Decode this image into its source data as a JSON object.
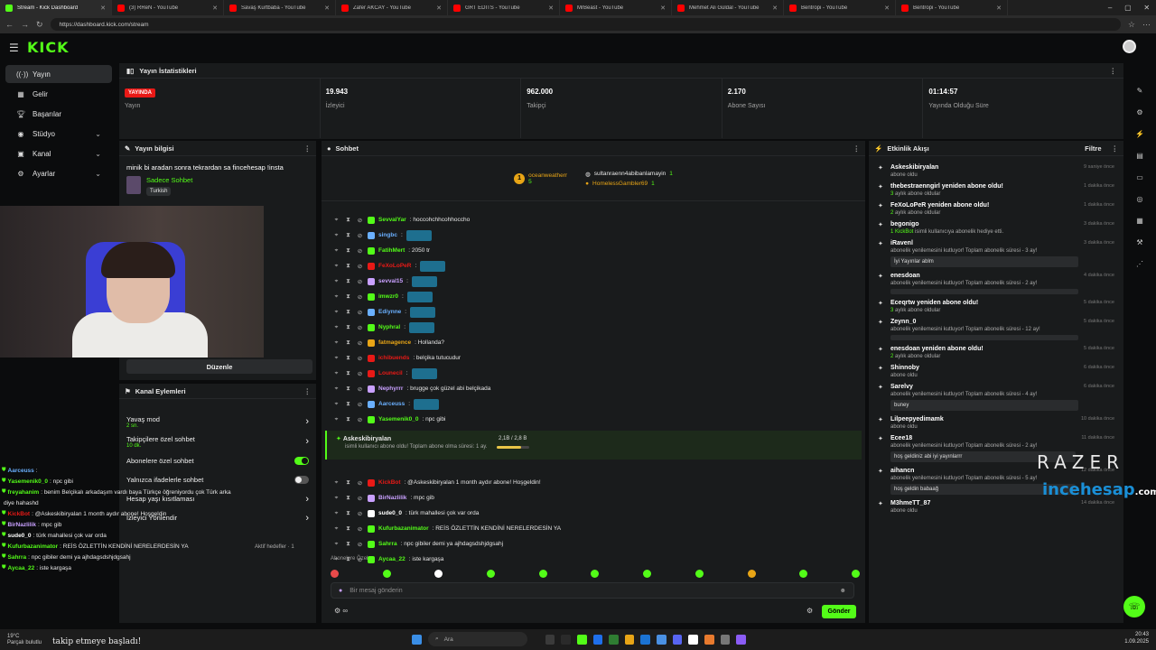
{
  "browser": {
    "tabs": [
      {
        "label": "Stream - Kick Dashboard",
        "color": "#53fc18",
        "active": true
      },
      {
        "label": "(3) RReN - YouTube",
        "color": "#ff0000"
      },
      {
        "label": "Savaş Kurtbaba - YouTube",
        "color": "#ff0000"
      },
      {
        "label": "Zafer AKCAY - YouTube",
        "color": "#ff0000"
      },
      {
        "label": "GRT EDİTS - YouTube",
        "color": "#ff0000"
      },
      {
        "label": "MrBeast - YouTube",
        "color": "#ff0000"
      },
      {
        "label": "Mehmet Ali Güldal - YouTube",
        "color": "#ff0000"
      },
      {
        "label": "Bentropi - YouTube",
        "color": "#ff0000"
      },
      {
        "label": "Bentropi - YouTube",
        "color": "#ff0000"
      }
    ],
    "url": "https://dashboard.kick.com/stream"
  },
  "topbar": {
    "logo": "KICK"
  },
  "sidebar": {
    "items": [
      {
        "label": "Yayın",
        "icon": "broadcast-icon",
        "glyph": "((·))",
        "chev": ""
      },
      {
        "label": "Gelir",
        "icon": "money-icon",
        "glyph": "▦",
        "chev": ""
      },
      {
        "label": "Başarılar",
        "icon": "trophy-icon",
        "glyph": "🏆︎",
        "chev": ""
      },
      {
        "label": "Stüdyo",
        "icon": "studio-icon",
        "glyph": "◉",
        "chev": "⌄"
      },
      {
        "label": "Kanal",
        "icon": "channel-icon",
        "glyph": "▣",
        "chev": "⌄"
      },
      {
        "label": "Ayarlar",
        "icon": "gear-icon",
        "glyph": "⚙",
        "chev": "⌄"
      }
    ]
  },
  "stats": {
    "title": "Yayın İstatistikleri",
    "live_badge": "YAYINDA",
    "live_label": "Yayın",
    "items": [
      {
        "value": "19.943",
        "label": "İzleyici"
      },
      {
        "value": "962.000",
        "label": "Takipçi"
      },
      {
        "value": "2.170",
        "label": "Abone Sayısı"
      },
      {
        "value": "01:14:57",
        "label": "Yayında Olduğu Süre"
      }
    ]
  },
  "info": {
    "title": "Yayın bilgisi",
    "stream_title": "minik bi aradan sonra tekrardan sa fincehesap !insta",
    "category": "Sadece Sohbet",
    "tag": "Turkish",
    "edit_button": "Düzenle"
  },
  "actions": {
    "title": "Kanal Eylemleri",
    "items": [
      {
        "label": "Yavaş mod",
        "sub": "2 sn.",
        "type": "chev"
      },
      {
        "label": "Takipçilere özel sohbet",
        "sub": "10 dk.",
        "type": "chev"
      },
      {
        "label": "Abonelere özel sohbet",
        "sub": "",
        "type": "on"
      },
      {
        "label": "Yalnızca ifadelerle sohbet",
        "sub": "",
        "type": "off"
      },
      {
        "label": "Hesap yaşı kısıtlaması",
        "sub": "",
        "type": "chev"
      },
      {
        "label": "İzleyici Yönlendir",
        "sub": "",
        "type": "chev"
      }
    ],
    "footer": "Aktif hedefler · 1"
  },
  "overlay_chat": [
    {
      "user": "Aarceuss",
      "color": "#6ab0ff",
      "text": ":"
    },
    {
      "user": "Yasemenik0_0",
      "color": "#53fc18",
      "text": ": npc gibi"
    },
    {
      "user": "freyahanim",
      "color": "#53fc18",
      "text": ": benim Belçikalı arkadaşım vardı baya Türkçe öğreniyordu çok Türk arka"
    },
    {
      "user": "",
      "color": "#ffffff",
      "text": "diye hahashd"
    },
    {
      "user": "KickBot",
      "color": "#e91916",
      "text": ": @Askeskibiryalan 1 month aydır abone! Hoşgeldin"
    },
    {
      "user": "BirNazlilik",
      "color": "#c9a0ff",
      "text": ": mpc gib"
    },
    {
      "user": "sude0_0",
      "color": "#ffffff",
      "text": ": türk mahallesi çok var orda"
    },
    {
      "user": "Kufurbazanimator",
      "color": "#53fc18",
      "text": ": REİS ÖZLETTİN KENDİNİ NERELERDESİN YA"
    },
    {
      "user": "Sahrra",
      "color": "#53fc18",
      "text": ": npc gibiler demi ya ajhdagsdshjdgsahj"
    },
    {
      "user": "Aycaa_22",
      "color": "#53fc18",
      "text": ": iste kargaşa"
    }
  ],
  "chat": {
    "title": "Sohbet",
    "leaders": [
      {
        "name": "oceanweatherr",
        "count": "5"
      },
      {
        "name": "sultanraenn4abibanlamayin",
        "count": "1"
      },
      {
        "name": "HomelessGambler69",
        "count": "1"
      }
    ],
    "messages": [
      {
        "user": "SevvalYar",
        "color": "#53fc18",
        "text": ": hoccohchhcohhoccho",
        "emote": false
      },
      {
        "user": "singbc",
        "color": "#6ab0ff",
        "text": ":",
        "emote": true
      },
      {
        "user": "FatihMert",
        "color": "#53fc18",
        "text": ": 2050 tr",
        "emote": false
      },
      {
        "user": "FeXoLoPeR",
        "color": "#e91916",
        "text": ":",
        "emote": true
      },
      {
        "user": "sevval15",
        "color": "#c9a0ff",
        "text": ":",
        "emote": true
      },
      {
        "user": "imwzr0",
        "color": "#53fc18",
        "text": ":",
        "emote": true
      },
      {
        "user": "Ediynne",
        "color": "#6ab0ff",
        "text": ":",
        "emote": true
      },
      {
        "user": "Nyphral",
        "color": "#53fc18",
        "text": ":",
        "emote": true
      },
      {
        "user": "fatmagence",
        "color": "#e8a516",
        "text": ": Hollanda?",
        "emote": false
      },
      {
        "user": "ichibuends",
        "color": "#e91916",
        "text": ": belçika tutucudur",
        "emote": false
      },
      {
        "user": "Lounecil",
        "color": "#e91916",
        "text": ":",
        "emote": true
      },
      {
        "user": "Nephyrrr",
        "color": "#c9a0ff",
        "text": ": brugge çok güzel abi belçikada",
        "emote": false
      },
      {
        "user": "Aarceuss",
        "color": "#6ab0ff",
        "text": ":",
        "emote": true
      },
      {
        "user": "Yasemenik0_0",
        "color": "#53fc18",
        "text": ": npc gibi",
        "emote": false
      },
      {
        "user": "freyahanim",
        "color": "#53fc18",
        "text": ": benim Belçikalı arkadaşım vardı baya Türkçe öğreniyordu çok Türk arkadaşı var diye hahashd",
        "emote": false
      }
    ],
    "sub_notice": {
      "user": "Askeskibiryalan",
      "text": "isimli kullanıcı abone oldu! Toplam abone olma süresi: 1 ay.",
      "progress_label": "2,1B / 2,8 B",
      "progress": 0.75
    },
    "messages2": [
      {
        "user": "KickBot",
        "color": "#e91916",
        "text": ": @Askeskibiryalan 1 month aydır abone! Hoşgeldin!"
      },
      {
        "user": "BirNazlilik",
        "color": "#c9a0ff",
        "text": ": mpc gib"
      },
      {
        "user": "sude0_0",
        "color": "#ffffff",
        "text": ": türk mahallesi çok var orda"
      },
      {
        "user": "Kufurbazanimator",
        "color": "#53fc18",
        "text": ": REİS ÖZLETTİN KENDİNİ NERELERDESİN YA"
      },
      {
        "user": "Sahrra",
        "color": "#53fc18",
        "text": ": npc gibiler demi ya ajhdagsdshjdgsahj"
      },
      {
        "user": "Aycaa_22",
        "color": "#53fc18",
        "text": ": iste kargaşa"
      }
    ],
    "subs_only_label": "Abonelere Özel",
    "placeholder": "Bir mesaj gönderin",
    "send": "Gönder"
  },
  "activity": {
    "title": "Etkinlik Akışı",
    "filter": "Filtre",
    "events": [
      {
        "name": "Askeskibiryalan",
        "desc": "abone oldu",
        "hl": "",
        "time": "9 saniye önce",
        "box": ""
      },
      {
        "name": "thebestraenngirl yeniden abone oldu!",
        "hl": "3",
        "desc": " aylık abone oldular",
        "time": "1 dakika önce",
        "box": ""
      },
      {
        "name": "FeXoLoPeR yeniden abone oldu!",
        "hl": "2",
        "desc": " aylık abone oldular",
        "time": "1 dakika önce",
        "box": ""
      },
      {
        "name": "begonigo",
        "hl": "1 KickBot",
        "desc": " isimli kullanıcıya abonelik hediye etti.",
        "time": "3 dakika önce",
        "box": ""
      },
      {
        "name": "iRavenl",
        "hl": "",
        "desc": "abonelik yenilemesini kutluyor! Toplam abonelik süresi - 3 ay!",
        "time": "3 dakika önce",
        "box": "İyi Yayınlar ablm"
      },
      {
        "name": "enesdoan",
        "hl": "",
        "desc": "abonelik yenilemesini kutluyor! Toplam abonelik süresi - 2 ay!",
        "time": "4 dakika önce",
        "box": " "
      },
      {
        "name": "Eceqrtw yeniden abone oldu!",
        "hl": "3",
        "desc": " aylık abone oldular",
        "time": "5 dakika önce",
        "box": ""
      },
      {
        "name": "Zeynn_0",
        "hl": "",
        "desc": "abonelik yenilemesini kutluyor! Toplam abonelik süresi - 12 ay!",
        "time": "5 dakika önce",
        "box": " "
      },
      {
        "name": "enesdoan yeniden abone oldu!",
        "hl": "2",
        "desc": " aylık abone oldular",
        "time": "5 dakika önce",
        "box": ""
      },
      {
        "name": "Shinnoby",
        "hl": "",
        "desc": "abone oldu",
        "time": "6 dakika önce",
        "box": ""
      },
      {
        "name": "Sarelvy",
        "hl": "",
        "desc": "abonelik yenilemesini kutluyor! Toplam abonelik süresi - 4 ay!",
        "time": "6 dakika önce",
        "box": "buney"
      },
      {
        "name": "Lilpeepyedimamk",
        "hl": "",
        "desc": "abone oldu",
        "time": "10 dakika önce",
        "box": ""
      },
      {
        "name": "Ecee18",
        "hl": "",
        "desc": "abonelik yenilemesini kutluyor! Toplam abonelik süresi - 2 ay!",
        "time": "11 dakika önce",
        "box": "hoş geldiniz abi iyi yayınlarrr"
      },
      {
        "name": "aihancn",
        "hl": "",
        "desc": "abonelik yenilemesini kutluyor! Toplam abonelik süresi - 5 ay!",
        "time": "12 dakika önce",
        "box": "hoş geldin babaağ"
      },
      {
        "name": "M3hmeTT_87",
        "hl": "",
        "desc": "abone oldu",
        "time": "14 dakika önce",
        "box": ""
      }
    ]
  },
  "watermark": {
    "brand": "RAZER",
    "site": "incehesap",
    "tld": ".com"
  },
  "taskbar": {
    "weather": "19°C",
    "weather_sub": "Parçalı bulutlu",
    "search": "Ara",
    "time": "20:43",
    "date": "1.09.2025"
  },
  "caption": "takip etmeye başladı!"
}
